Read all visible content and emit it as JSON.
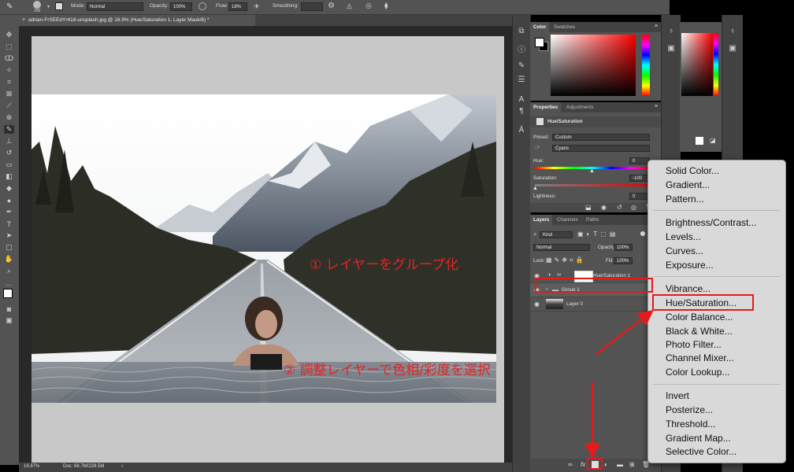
{
  "options_bar": {
    "brush_size": "200",
    "mode_label": "Mode:",
    "mode_value": "Normal",
    "opacity_label": "Opacity:",
    "opacity_value": "100%",
    "flow_label": "Flow:",
    "flow_value": "18%",
    "smoothing_label": "Smoothing:"
  },
  "document": {
    "tab_title": "adrian-FrSEEdYr418-unsplash.jpg @ 16.9% (Hue/Saturation 1, Layer Mask/8) *"
  },
  "status_bar": {
    "zoom": "16.87%",
    "doc_size": "Doc: 68.7M/228.5M"
  },
  "color_panel": {
    "tabs": [
      "Color",
      "Swatches"
    ]
  },
  "properties_panel": {
    "tabs": [
      "Properties",
      "Adjustments"
    ],
    "title": "Hue/Saturation",
    "preset_label": "Preset:",
    "preset_value": "Custom",
    "channel_value": "Cyans",
    "hue_label": "Hue:",
    "hue_value": "0",
    "saturation_label": "Saturation:",
    "saturation_value": "-100",
    "lightness_label": "Lightness:",
    "lightness_value": "0"
  },
  "layers_panel": {
    "tabs": [
      "Layers",
      "Channels",
      "Paths"
    ],
    "filter_value": "Kind",
    "blend_value": "Normal",
    "opacity_label": "Opacity:",
    "opacity_value": "100%",
    "lock_label": "Lock:",
    "fill_label": "Fill:",
    "fill_value": "100%",
    "layers": [
      {
        "name": "Hue/Saturation 1"
      },
      {
        "name": "Group 1"
      },
      {
        "name": "Layer 0"
      }
    ]
  },
  "context_menu": {
    "group1": [
      "Solid Color...",
      "Gradient...",
      "Pattern..."
    ],
    "group2": [
      "Brightness/Contrast...",
      "Levels...",
      "Curves...",
      "Exposure..."
    ],
    "group3": [
      "Vibrance...",
      "Hue/Saturation...",
      "Color Balance...",
      "Black & White...",
      "Photo Filter...",
      "Channel Mixer...",
      "Color Lookup..."
    ],
    "group4": [
      "Invert",
      "Posterize...",
      "Threshold...",
      "Gradient Map...",
      "Selective Color..."
    ]
  },
  "annotations": {
    "step1": "① レイヤーをグループ化",
    "step2": "② 調整レイヤーで色相/彩度を選択"
  },
  "colors": {
    "annotation_red": "#e32424",
    "ui_panel": "#535353",
    "ui_dark": "#424242",
    "menu_bg": "#d9d9d9"
  }
}
